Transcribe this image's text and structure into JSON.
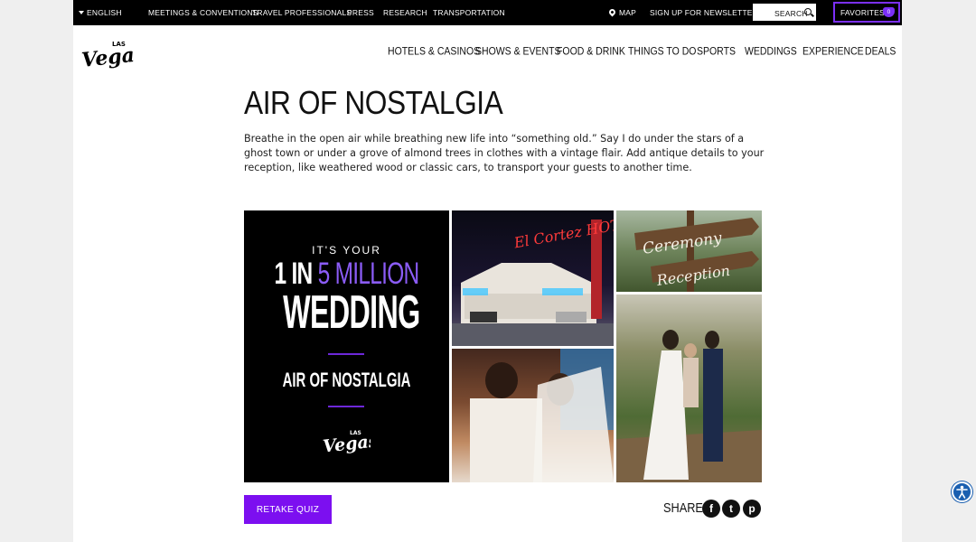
{
  "topbar": {
    "language": "ENGLISH",
    "links": [
      "MEETINGS & CONVENTIONS",
      "TRAVEL PROFESSIONALS",
      "PRESS",
      "RESEARCH",
      "TRANSPORTATION"
    ],
    "map": "MAP",
    "newsletter": "SIGN UP FOR NEWSLETTER",
    "search": "SEARCH",
    "favorites": "FAVORITES",
    "favorites_count": "0"
  },
  "nav": [
    "HOTELS & CASINOS",
    "SHOWS & EVENTS",
    "FOOD & DRINK",
    "THINGS TO DO",
    "SPORTS",
    "WEDDINGS",
    "EXPERIENCE",
    "DEALS"
  ],
  "logo": {
    "top": "LAS",
    "main": "Vegas"
  },
  "content": {
    "title": "AIR OF NOSTALGIA",
    "description": "Breathe in the open air while breathing new life into “something old.” Say I do under the stars of a ghost town or under a grove of almond trees in clothes with a vintage flair. Add antique details to your reception, like weathered wood or classic cars, to transport your guests to another time."
  },
  "collage": {
    "its_your": "IT'S YOUR",
    "one_in": "1 IN",
    "five_million": "5 MILLION",
    "wedding": "WEDDING",
    "air_of_nostalgia": "AIR OF NOSTALGIA",
    "hotel_sign": "El Cortez HOTEL",
    "sign_ceremony": "Ceremony",
    "sign_reception": "Reception"
  },
  "actions": {
    "retake_quiz": "RETAKE QUIZ",
    "share": "SHARE",
    "social": [
      {
        "name": "facebook",
        "glyph": "f"
      },
      {
        "name": "twitter",
        "glyph": "t"
      },
      {
        "name": "pinterest",
        "glyph": "p"
      }
    ]
  },
  "colors": {
    "accent": "#7c0ff0",
    "topbar": "#000000",
    "favorites_border": "#7b2ff7"
  }
}
